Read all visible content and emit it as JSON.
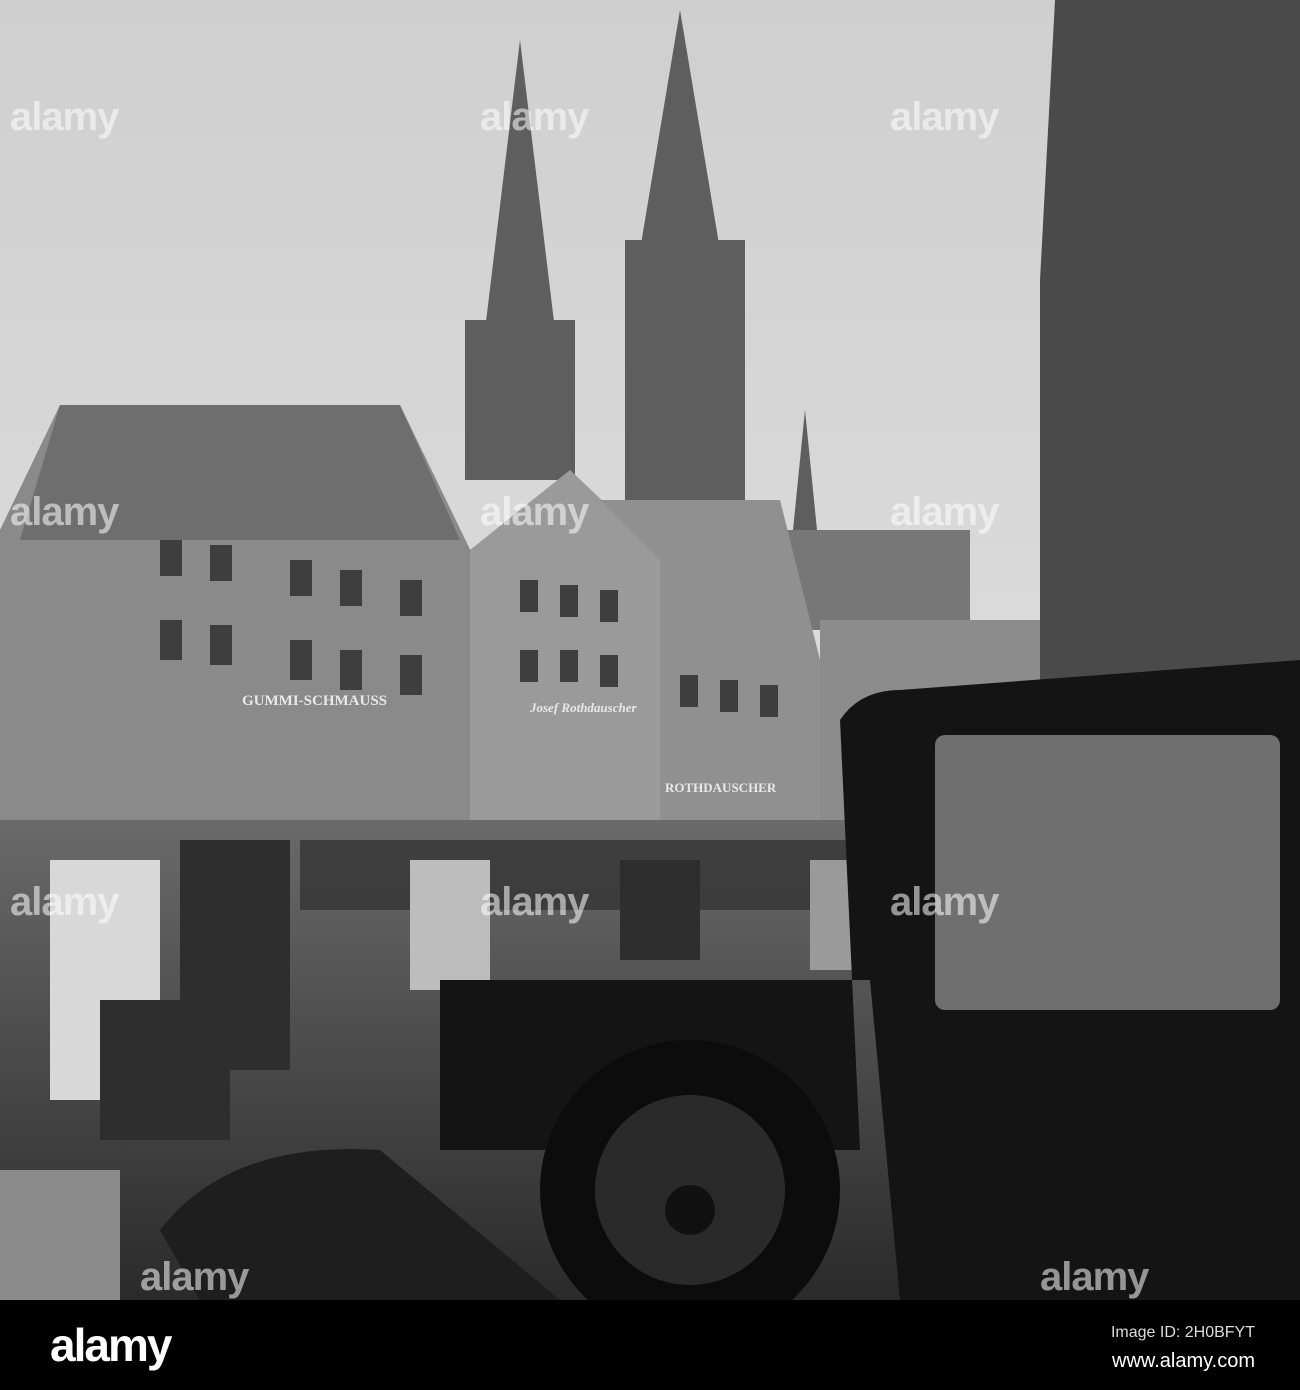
{
  "watermark": {
    "text": "alamy"
  },
  "photo": {
    "signs": {
      "shop_left": "GUMMI-SCHMAUSS",
      "shop_center": "Josef Rothdauscher",
      "shop_right": "ROTHDAUSCHER"
    }
  },
  "footer": {
    "logo": "alamy",
    "image_id": "Image ID: 2H0BFYT",
    "url": "www.alamy.com"
  }
}
